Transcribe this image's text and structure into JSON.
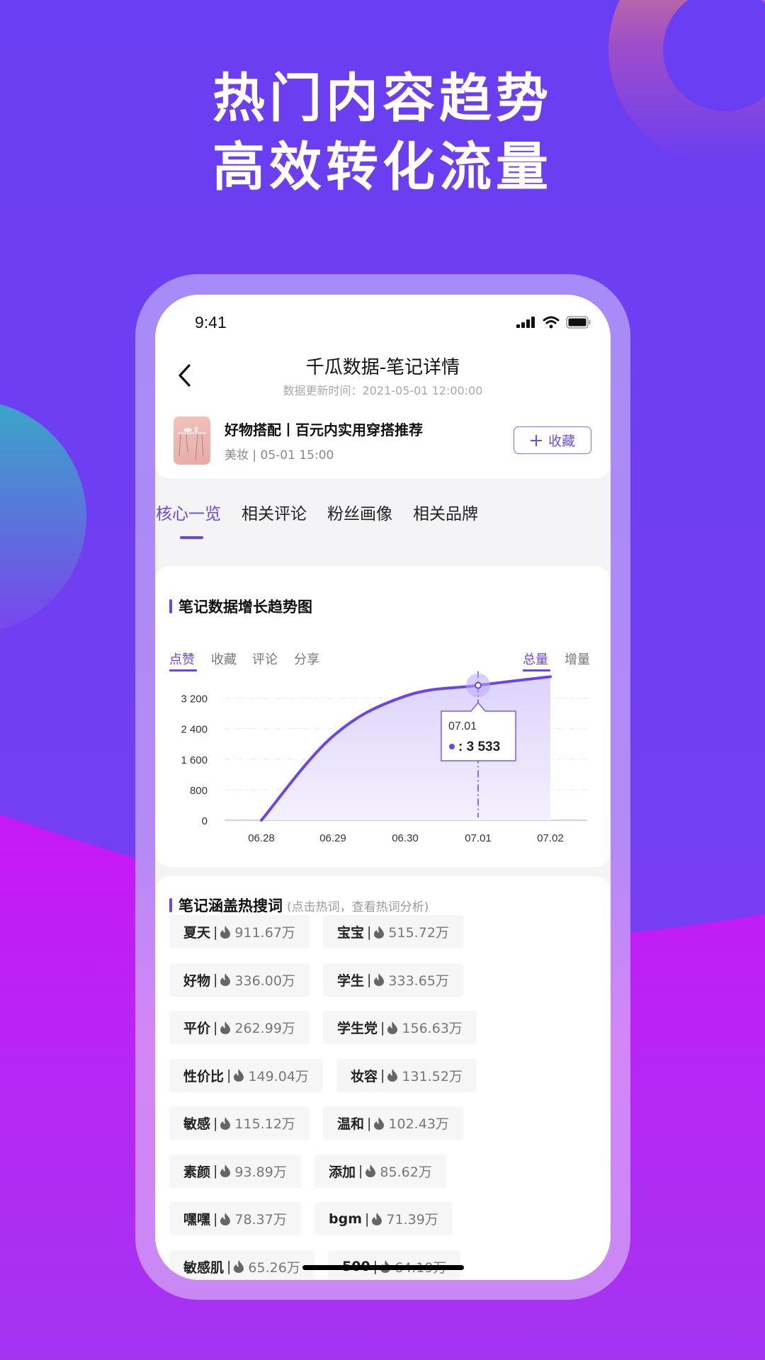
{
  "promo": {
    "headline_line1": "热门内容趋势",
    "headline_line2": "高效转化流量"
  },
  "status_bar": {
    "time": "9:41",
    "icons": [
      "signal-icon",
      "wifi-icon",
      "battery-icon"
    ]
  },
  "nav": {
    "back_icon": "chevron-left-icon",
    "title": "千瓜数据-笔记详情",
    "subtitle": "数据更新时间：2021-05-01 12:00:00"
  },
  "note": {
    "title": "好物搭配丨百元内实用穿搭推荐",
    "meta": "美妆 | 05-01 15:00",
    "favorite_button": "收藏",
    "favorite_icon": "plus-icon"
  },
  "tabs": [
    {
      "label": "核心一览",
      "active": true
    },
    {
      "label": "相关评论",
      "active": false
    },
    {
      "label": "粉丝画像",
      "active": false
    },
    {
      "label": "相关品牌",
      "active": false
    }
  ],
  "trend": {
    "title": "笔记数据增长趋势图",
    "metric_tabs": [
      {
        "label": "点赞",
        "active": true
      },
      {
        "label": "收藏",
        "active": false
      },
      {
        "label": "评论",
        "active": false
      },
      {
        "label": "分享",
        "active": false
      }
    ],
    "mode_tabs": [
      {
        "label": "总量",
        "active": true
      },
      {
        "label": "增量",
        "active": false
      }
    ],
    "tooltip": {
      "date": "07.01",
      "value_label": ": 3 533"
    }
  },
  "chart_data": {
    "type": "area",
    "title": "笔记数据增长趋势图",
    "xlabel": "",
    "ylabel": "",
    "categories": [
      "06.28",
      "06.29",
      "06.30",
      "07.01",
      "07.02"
    ],
    "series": [
      {
        "name": "点赞",
        "values": [
          0,
          2200,
          3250,
          3533,
          3760
        ]
      }
    ],
    "yticks": [
      0,
      800,
      1600,
      2400,
      3200
    ],
    "ytick_labels": [
      "0",
      "800",
      "1 600",
      "2 400",
      "3 200"
    ],
    "ylim": [
      0,
      3800
    ],
    "grid": true,
    "highlight": {
      "category": "07.01",
      "value": 3533
    },
    "colors": {
      "line": "#6a45ef",
      "fill": "#ece6fd"
    }
  },
  "hotwords": {
    "title": "笔记涵盖热搜词",
    "hint": "(点击热词，查看热词分析)",
    "items": [
      {
        "word": "夏天",
        "value": "911.67万"
      },
      {
        "word": "宝宝",
        "value": "515.72万"
      },
      {
        "word": "好物",
        "value": "336.00万"
      },
      {
        "word": "学生",
        "value": "333.65万"
      },
      {
        "word": "平价",
        "value": "262.99万"
      },
      {
        "word": "学生党",
        "value": "156.63万"
      },
      {
        "word": "性价比",
        "value": "149.04万"
      },
      {
        "word": "妆容",
        "value": "131.52万"
      },
      {
        "word": "敏感",
        "value": "115.12万"
      },
      {
        "word": "温和",
        "value": "102.43万"
      },
      {
        "word": "素颜",
        "value": "93.89万"
      },
      {
        "word": "添加",
        "value": "85.62万"
      },
      {
        "word": "嘿嘿",
        "value": "78.37万"
      },
      {
        "word": "bgm",
        "value": "71.39万"
      },
      {
        "word": "敏感肌",
        "value": "65.26万"
      },
      {
        "word": "500",
        "value": "64.19万"
      }
    ]
  },
  "colors": {
    "accent": "#6a45ef",
    "bg_top": "#6a3ef2",
    "bg_bottom": "#c51af5"
  }
}
